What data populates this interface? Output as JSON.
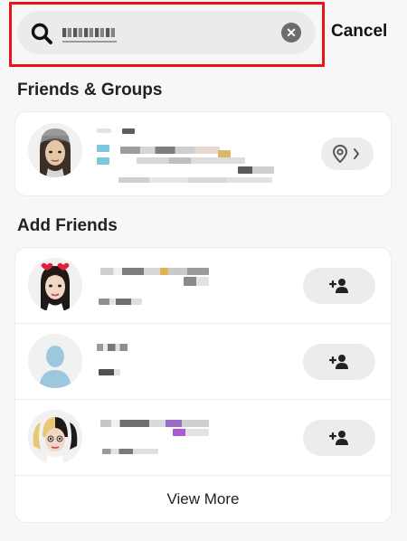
{
  "search": {
    "query": "pacsi",
    "cancel_label": "Cancel"
  },
  "friends_groups": {
    "heading": "Friends & Groups",
    "items": [
      {
        "name": "",
        "action_icon": "location-pin-icon"
      }
    ]
  },
  "add_friends": {
    "heading": "Add Friends",
    "items": [
      {
        "name": "",
        "action_icon": "add-friend-icon"
      },
      {
        "name": "",
        "action_icon": "add-friend-icon"
      },
      {
        "name": "",
        "action_icon": "add-friend-icon"
      }
    ],
    "view_more_label": "View More"
  },
  "colors": {
    "highlight": "#e8141b",
    "search_bg": "#ebebeb",
    "card_bg": "#ffffff",
    "page_bg": "#f7f7f7",
    "button_bg": "#ececec"
  }
}
